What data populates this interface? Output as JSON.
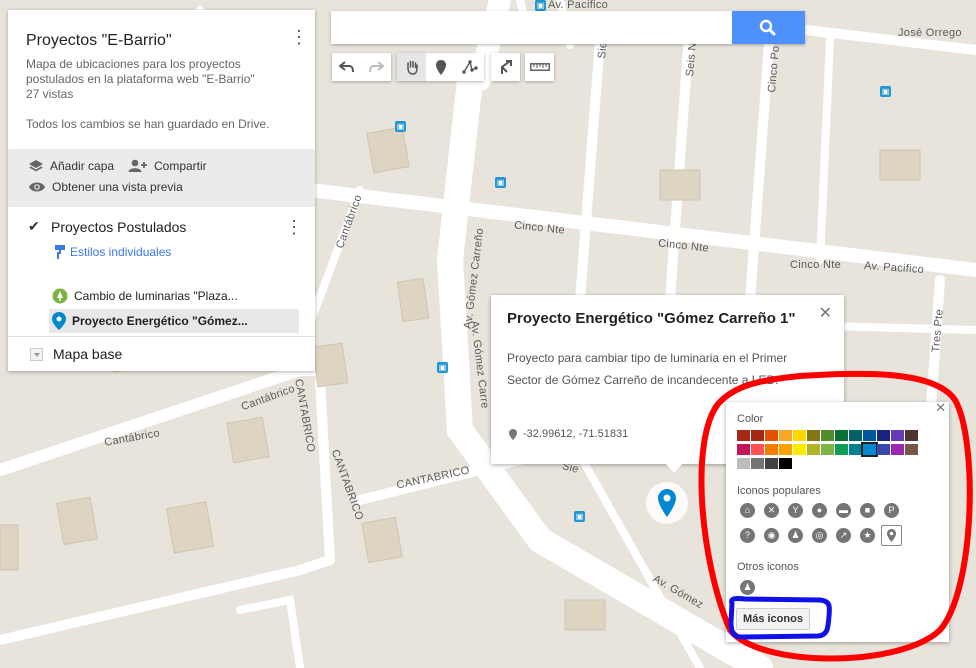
{
  "map": {
    "streets": {
      "av_pacifico_top": "Av. Pacifico",
      "jose_orrego": "José Orrego",
      "siete_norte": "Siete N",
      "seis_norte": "Seis N",
      "cinco_poniente": "Cinco Po",
      "cantabrico_1": "Cantábrico",
      "cinco_nte_1": "Cinco Nte",
      "cinco_nte_2": "Cinco Nte",
      "cinco_nte_3": "Cinco Nte",
      "av_pacifico_right": "Av. Pacifico",
      "av_gomez_carreno_1": "Av. Gómez Carreño",
      "av_gomez_carreno_2": "Av. Gómez Carre",
      "cantabrico_2": "Cantábrico",
      "cantabrico_3": "Cantábrico",
      "cantabrico_upper_1": "CANTABRICO",
      "cantabrico_upper_2": "CANTABRICO",
      "cantabrico_upper_3": "CANTABRICO",
      "tres_pte": "Tres Pte",
      "av_gomez_bottom": "Av. Gómez",
      "siete_bottom": "Sie"
    },
    "bus_glyph": "▣"
  },
  "panel": {
    "title": "Proyectos \"E-Barrio\"",
    "description": "Mapa de ubicaciones para los proyectos postulados en la plataforma web \"E-Barrio\"",
    "views": "27 vistas",
    "saved": "Todos los cambios se han guardado en Drive.",
    "add_layer": "Añadir capa",
    "share": "Compartir",
    "preview": "Obtener una vista previa",
    "layer_name": "Proyectos Postulados",
    "styles_link": "Estilos individuales",
    "features": [
      {
        "label": "Cambio de luminarias \"Plaza..."
      },
      {
        "label": "Proyecto Energético \"Gómez..."
      }
    ],
    "basemap": "Mapa base"
  },
  "search": {
    "placeholder": "",
    "value": ""
  },
  "popup": {
    "title": "Proyecto Energético \"Gómez Carreño 1\"",
    "body": "Proyecto para cambiar tipo de luminaria en el Primer Sector de Gómez Carreño de incandecente a LED.",
    "coords": "-32.99612, -71.51831"
  },
  "picker": {
    "color_label": "Color",
    "popular_label": "Iconos populares",
    "other_label": "Otros iconos",
    "more_button": "Más iconos",
    "colors": [
      "#a52714",
      "#a52714",
      "#e65100",
      "#f9a825",
      "#ffd600",
      "#817717",
      "#558b2f",
      "#097138",
      "#006064",
      "#01579b",
      "#1a237e",
      "#673ab7",
      "#4e342e",
      "#c2185b",
      "#ff5252",
      "#f57c00",
      "#ffa000",
      "#ffea00",
      "#afb42b",
      "#7cb342",
      "#0f9d58",
      "#00838f",
      "#0288d1",
      "#3949ab",
      "#9c27b0",
      "#795548",
      "#bdbdbd",
      "#757575",
      "#424242",
      "#000000"
    ],
    "selected_color_index": 22,
    "popular_icons": [
      "home-icon",
      "restaurant-icon",
      "bar-icon",
      "chat-icon",
      "hotel-icon",
      "shopping-icon",
      "parking-icon",
      "help-icon",
      "camera-icon",
      "walk-icon",
      "bike-icon",
      "run-icon",
      "star-icon",
      "pin-icon"
    ],
    "popular_glyphs": [
      "⌂",
      "✕",
      "Y",
      "●",
      "▬",
      "■",
      "P",
      "?",
      "◉",
      "♟",
      "◎",
      "↗",
      "★",
      "●"
    ]
  },
  "colors": {
    "accent": "#4d90fe",
    "marker": "#0288d1",
    "annotation_red": "#ff0000",
    "annotation_blue": "#0000ff"
  }
}
